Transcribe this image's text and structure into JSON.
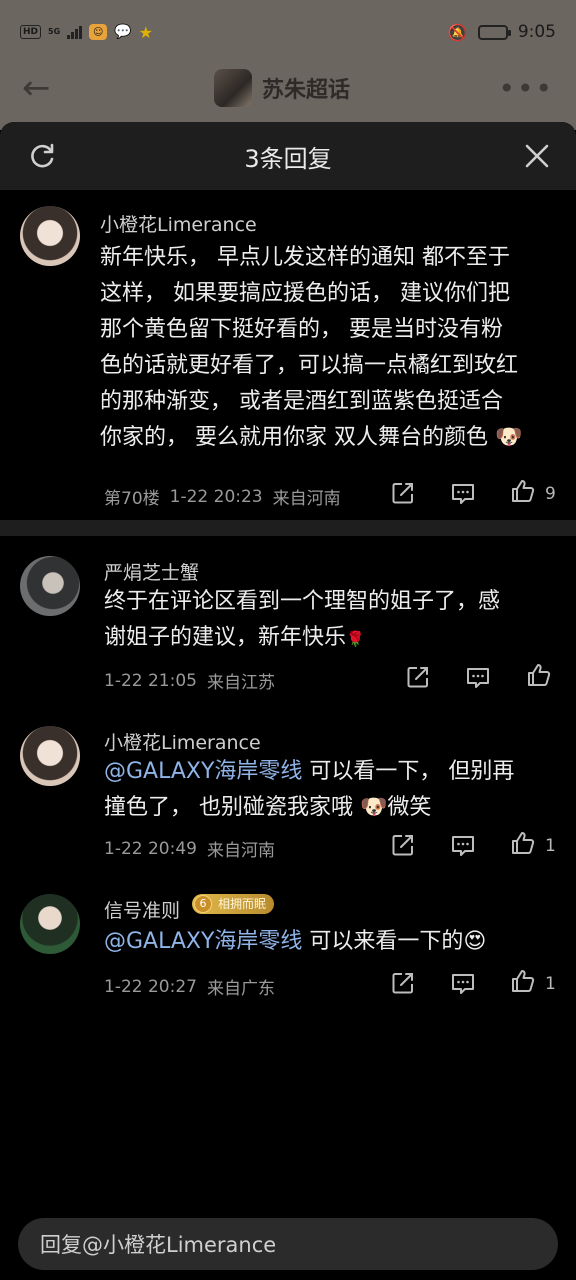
{
  "status_bar": {
    "hd": "HD",
    "network": "5G",
    "time": "9:05",
    "battery_level": 0.85
  },
  "topbar": {
    "topic_title": "苏朱超话"
  },
  "sheet": {
    "title": "3条回复"
  },
  "main_comment": {
    "username": "小橙花Limerance",
    "lines": [
      "新年快乐， 早点儿发这样的通知 都不至于",
      "这样， 如果要搞应援色的话， 建议你们把",
      "那个黄色留下挺好看的， 要是当时没有粉",
      "色的话就更好看了，可以搞一点橘红到玫红",
      "的那种渐变， 或者是酒红到蓝紫色挺适合",
      "你家的， 要么就用你家 双人舞台的颜色"
    ],
    "floor": "第70楼",
    "time": "1-22 20:23",
    "location": "来自河南",
    "likes": "9"
  },
  "replies": [
    {
      "username": "严焆芝士蟹",
      "lines": [
        "终于在评论区看到一个理智的姐子了，感",
        "谢姐子的建议，新年快乐"
      ],
      "time": "1-22 21:05",
      "location": "来自江苏",
      "likes": ""
    },
    {
      "username": "小橙花Limerance",
      "mention": "@GALAXY海岸零线",
      "line1_rest": " 可以看一下， 但别再",
      "line2": "撞色了， 也别碰瓷我家哦 ",
      "line2_tail": "微笑",
      "time": "1-22 20:49",
      "location": "来自河南",
      "likes": "1"
    },
    {
      "username": "信号准则",
      "badge_level": "6",
      "badge_text": "相拥而眠",
      "mention": "@GALAXY海岸零线",
      "line1_rest": " 可以来看一下的",
      "time": "1-22 20:27",
      "location": "来自广东",
      "likes": "1"
    }
  ],
  "reply_box": {
    "placeholder": "回复@小橙花Limerance"
  }
}
